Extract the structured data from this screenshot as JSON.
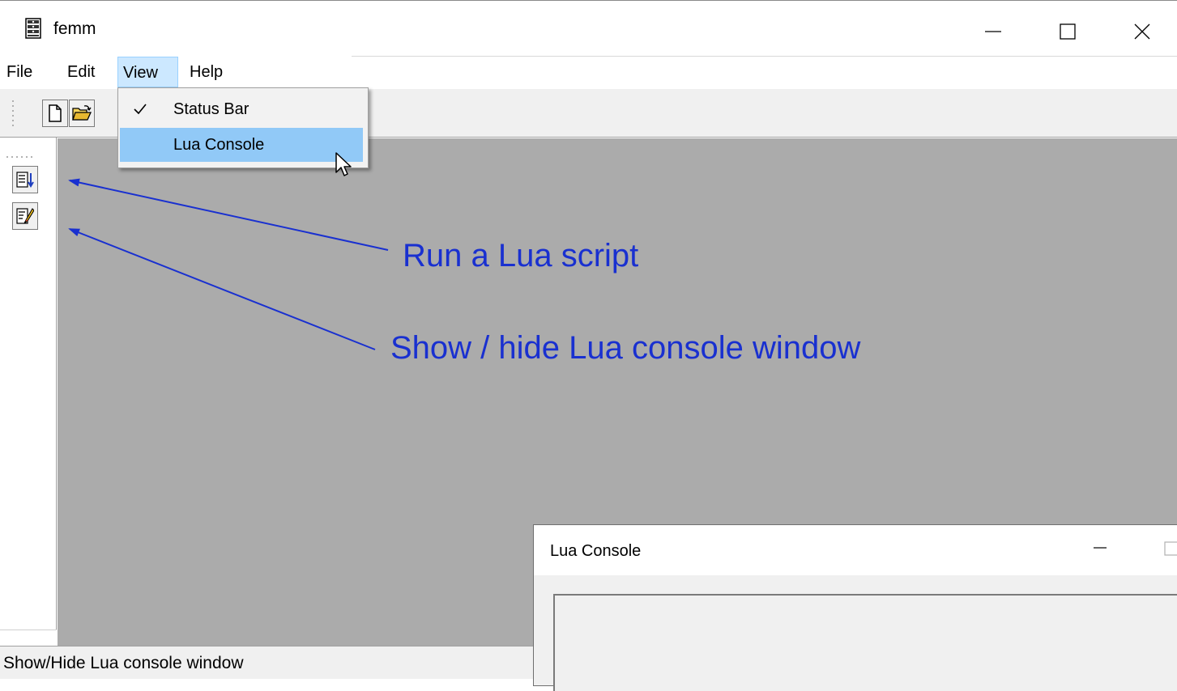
{
  "window": {
    "title": "femm",
    "controls": [
      "minimize",
      "maximize",
      "close"
    ]
  },
  "menubar": {
    "items": [
      "File",
      "Edit",
      "View",
      "Help"
    ],
    "active": "View"
  },
  "view_menu": {
    "items": [
      {
        "label": "Status Bar",
        "checked": true
      },
      {
        "label": "Lua Console",
        "checked": false,
        "highlighted": true
      }
    ]
  },
  "toolbar": {
    "buttons": [
      "new-document-icon",
      "open-folder-icon"
    ]
  },
  "left_toolbar": {
    "buttons": [
      "run-lua-script-icon",
      "lua-console-icon"
    ]
  },
  "annotations": {
    "run_script": "Run a Lua script",
    "show_hide_console": "Show / hide Lua console window"
  },
  "status_bar": {
    "text": "Show/Hide Lua console window"
  },
  "lua_console": {
    "title": "Lua Console"
  },
  "colors": {
    "annotation": "#1930d0",
    "mdi_background": "#ababab",
    "menu_highlight": "#91c9f7",
    "menu_active": "#cce8ff"
  }
}
